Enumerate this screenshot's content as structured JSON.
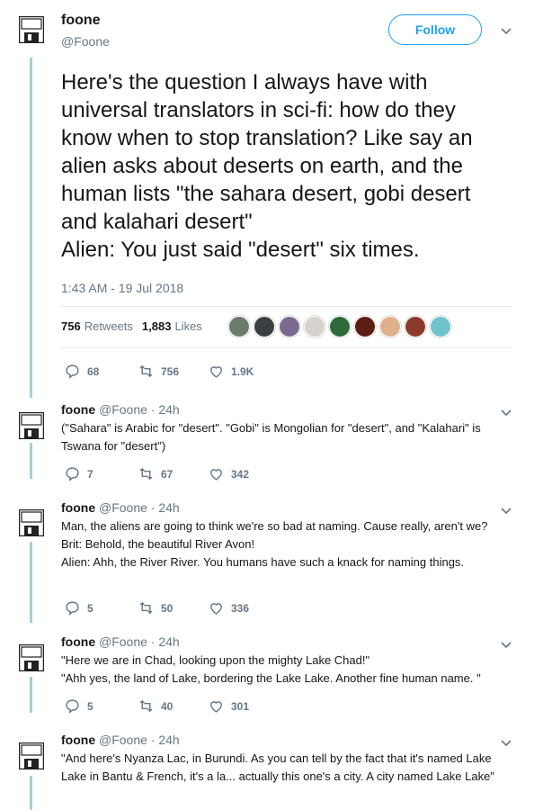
{
  "main": {
    "name": "foone",
    "handle": "@Foone",
    "follow_label": "Follow",
    "text": "Here's the question I always have with universal translators in sci-fi: how do they know when to stop translation? Like say an alien asks about deserts on earth, and the human lists \"the sahara desert, gobi desert and kalahari desert\"\nAlien: You just said \"desert\" six times.",
    "timestamp": "1:43 AM - 19 Jul 2018",
    "retweets_count": "756",
    "retweets_label": "Retweets",
    "likes_count": "1,883",
    "likes_label": "Likes",
    "actions": {
      "replies": "68",
      "retweets": "756",
      "likes": "1.9K"
    }
  },
  "liker_colors": [
    "#6b7b6e",
    "#3a3f44",
    "#7b6a8f",
    "#d8d2cc",
    "#2e6a3a",
    "#5a1e12",
    "#e0b08a",
    "#8a3b2a",
    "#6fc2c9"
  ],
  "replies": [
    {
      "name": "foone",
      "meta": "@Foone · 24h",
      "text": "(\"Sahara\" is Arabic for \"desert\". \"Gobi\" is Mongolian for \"desert\", and \"Kalahari\" is Tswana for \"desert\")",
      "replies": "7",
      "retweets": "67",
      "likes": "342"
    },
    {
      "name": "foone",
      "meta": "@Foone · 24h",
      "text": "Man, the aliens are going to think we're so bad at naming. Cause really, aren't we?\nBrit: Behold, the beautiful River Avon!\nAlien: Ahh, the River River. You humans have such a knack for naming things.",
      "replies": "5",
      "retweets": "50",
      "likes": "336"
    },
    {
      "name": "foone",
      "meta": "@Foone · 24h",
      "text": "\"Here we are in Chad, looking upon the mighty Lake Chad!\"\n\"Ahh yes, the land of Lake, bordering the Lake Lake. Another fine human name. \"",
      "replies": "5",
      "retweets": "40",
      "likes": "301"
    },
    {
      "name": "foone",
      "meta": "@Foone · 24h",
      "text": "\"And here's Nyanza Lac, in Burundi. As you can tell by the fact that it's named Lake Lake in Bantu & French, it's a la... actually this one's a city. A city named Lake Lake\""
    }
  ],
  "icons": {
    "avatar": "floppy-disk-icon",
    "menu": "chevron-down-icon",
    "reply": "reply-icon",
    "retweet": "retweet-icon",
    "like": "heart-icon"
  }
}
